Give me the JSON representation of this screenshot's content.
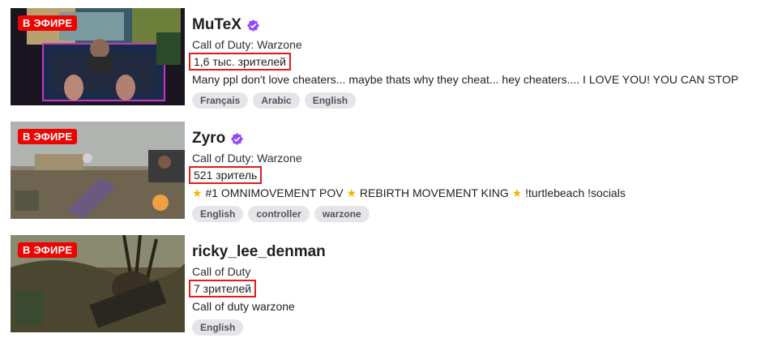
{
  "live_badge": "В ЭФИРЕ",
  "results": [
    {
      "channel": "MuTeX",
      "verified": true,
      "game": "Call of Duty: Warzone",
      "viewers": "1,6 тыс. зрителей",
      "title": "Many ppl don't love cheaters... maybe thats why they cheat... hey cheaters.... I LOVE YOU! YOU CAN STOP",
      "tags": [
        "Français",
        "Arabic",
        "English"
      ]
    },
    {
      "channel": "Zyro",
      "verified": true,
      "game": "Call of Duty: Warzone",
      "viewers": "521 зритель",
      "title_parts": [
        "#1 OMNIMOVEMENT POV",
        "REBIRTH MOVEMENT KING",
        "!turtlebeach !socials"
      ],
      "title_icon": "star-emoji-icon",
      "tags": [
        "English",
        "controller",
        "warzone"
      ]
    },
    {
      "channel": "ricky_lee_denman",
      "verified": false,
      "game": "Call of Duty",
      "viewers": "7 зрителей",
      "title": "Call of duty warzone",
      "tags": [
        "English"
      ]
    }
  ],
  "colors": {
    "live_badge": "#eb0400",
    "verified": "#9147ff",
    "highlight_box": "#e31b1b",
    "tag_bg": "#e5e5e9"
  }
}
